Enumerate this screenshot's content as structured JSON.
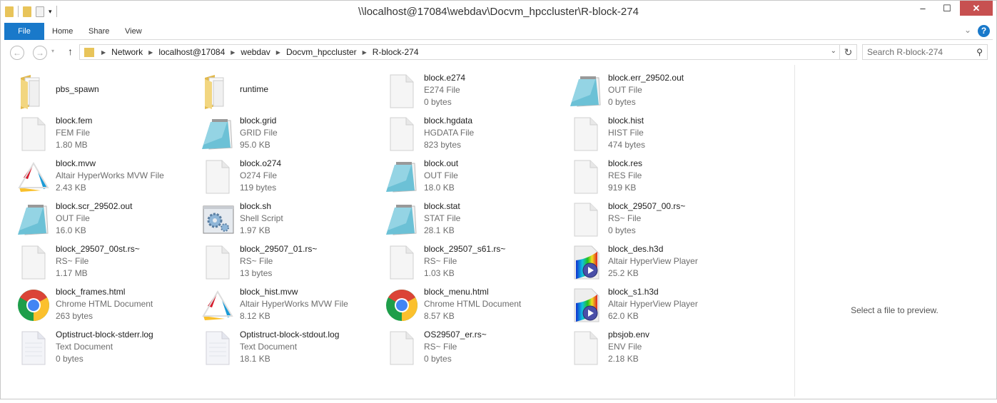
{
  "window": {
    "title": "\\\\localhost@17084\\webdav\\Docvm_hpccluster\\R-block-274",
    "minimize": "–",
    "maximize": "☐",
    "close": "✕"
  },
  "ribbon": {
    "tabs": [
      "File",
      "Home",
      "Share",
      "View"
    ],
    "help": "?",
    "collapse": "⌄"
  },
  "nav": {
    "back": "←",
    "forward": "→",
    "recent": "▾",
    "up": "↑",
    "breadcrumb": [
      "Network",
      "localhost@17084",
      "webdav",
      "Docvm_hpccluster",
      "R-block-274"
    ],
    "refresh": "↻",
    "search_placeholder": "Search R-block-274",
    "search_icon": "⚲"
  },
  "files": [
    {
      "name": "pbs_spawn",
      "icon": "folder"
    },
    {
      "name": "runtime",
      "icon": "folder"
    },
    {
      "name": "block.e274",
      "type": "E274 File",
      "size": "0 bytes",
      "icon": "blank"
    },
    {
      "name": "block.err_29502.out",
      "type": "OUT File",
      "size": "0 bytes",
      "icon": "notepad"
    },
    {
      "name": "block.fem",
      "type": "FEM File",
      "size": "1.80 MB",
      "icon": "blank"
    },
    {
      "name": "block.grid",
      "type": "GRID File",
      "size": "95.0 KB",
      "icon": "notepad"
    },
    {
      "name": "block.hgdata",
      "type": "HGDATA File",
      "size": "823 bytes",
      "icon": "blank"
    },
    {
      "name": "block.hist",
      "type": "HIST File",
      "size": "474 bytes",
      "icon": "blank"
    },
    {
      "name": "block.mvw",
      "type": "Altair HyperWorks MVW File",
      "size": "2.43 KB",
      "icon": "mvw"
    },
    {
      "name": "block.o274",
      "type": "O274 File",
      "size": "119 bytes",
      "icon": "blank"
    },
    {
      "name": "block.out",
      "type": "OUT File",
      "size": "18.0 KB",
      "icon": "notepad"
    },
    {
      "name": "block.res",
      "type": "RES File",
      "size": "919 KB",
      "icon": "blank"
    },
    {
      "name": "block.scr_29502.out",
      "type": "OUT File",
      "size": "16.0 KB",
      "icon": "notepad"
    },
    {
      "name": "block.sh",
      "type": "Shell Script",
      "size": "1.97 KB",
      "icon": "gear"
    },
    {
      "name": "block.stat",
      "type": "STAT File",
      "size": "28.1 KB",
      "icon": "notepad"
    },
    {
      "name": "block_29507_00.rs~",
      "type": "RS~ File",
      "size": "0 bytes",
      "icon": "blank"
    },
    {
      "name": "block_29507_00st.rs~",
      "type": "RS~ File",
      "size": "1.17 MB",
      "icon": "blank"
    },
    {
      "name": "block_29507_01.rs~",
      "type": "RS~ File",
      "size": "13 bytes",
      "icon": "blank"
    },
    {
      "name": "block_29507_s61.rs~",
      "type": "RS~ File",
      "size": "1.03 KB",
      "icon": "blank"
    },
    {
      "name": "block_des.h3d",
      "type": "Altair HyperView Player",
      "size": "25.2 KB",
      "icon": "h3d"
    },
    {
      "name": "block_frames.html",
      "type": "Chrome HTML Document",
      "size": "263 bytes",
      "icon": "chrome"
    },
    {
      "name": "block_hist.mvw",
      "type": "Altair HyperWorks MVW File",
      "size": "8.12 KB",
      "icon": "mvw"
    },
    {
      "name": "block_menu.html",
      "type": "Chrome HTML Document",
      "size": "8.57 KB",
      "icon": "chrome"
    },
    {
      "name": "block_s1.h3d",
      "type": "Altair HyperView Player",
      "size": "62.0 KB",
      "icon": "h3d"
    },
    {
      "name": "Optistruct-block-stderr.log",
      "type": "Text Document",
      "size": "0 bytes",
      "icon": "text"
    },
    {
      "name": "Optistruct-block-stdout.log",
      "type": "Text Document",
      "size": "18.1 KB",
      "icon": "text"
    },
    {
      "name": "OS29507_er.rs~",
      "type": "RS~ File",
      "size": "0 bytes",
      "icon": "blank"
    },
    {
      "name": "pbsjob.env",
      "type": "ENV File",
      "size": "2.18 KB",
      "icon": "blank"
    }
  ],
  "preview": {
    "message": "Select a file to preview."
  }
}
